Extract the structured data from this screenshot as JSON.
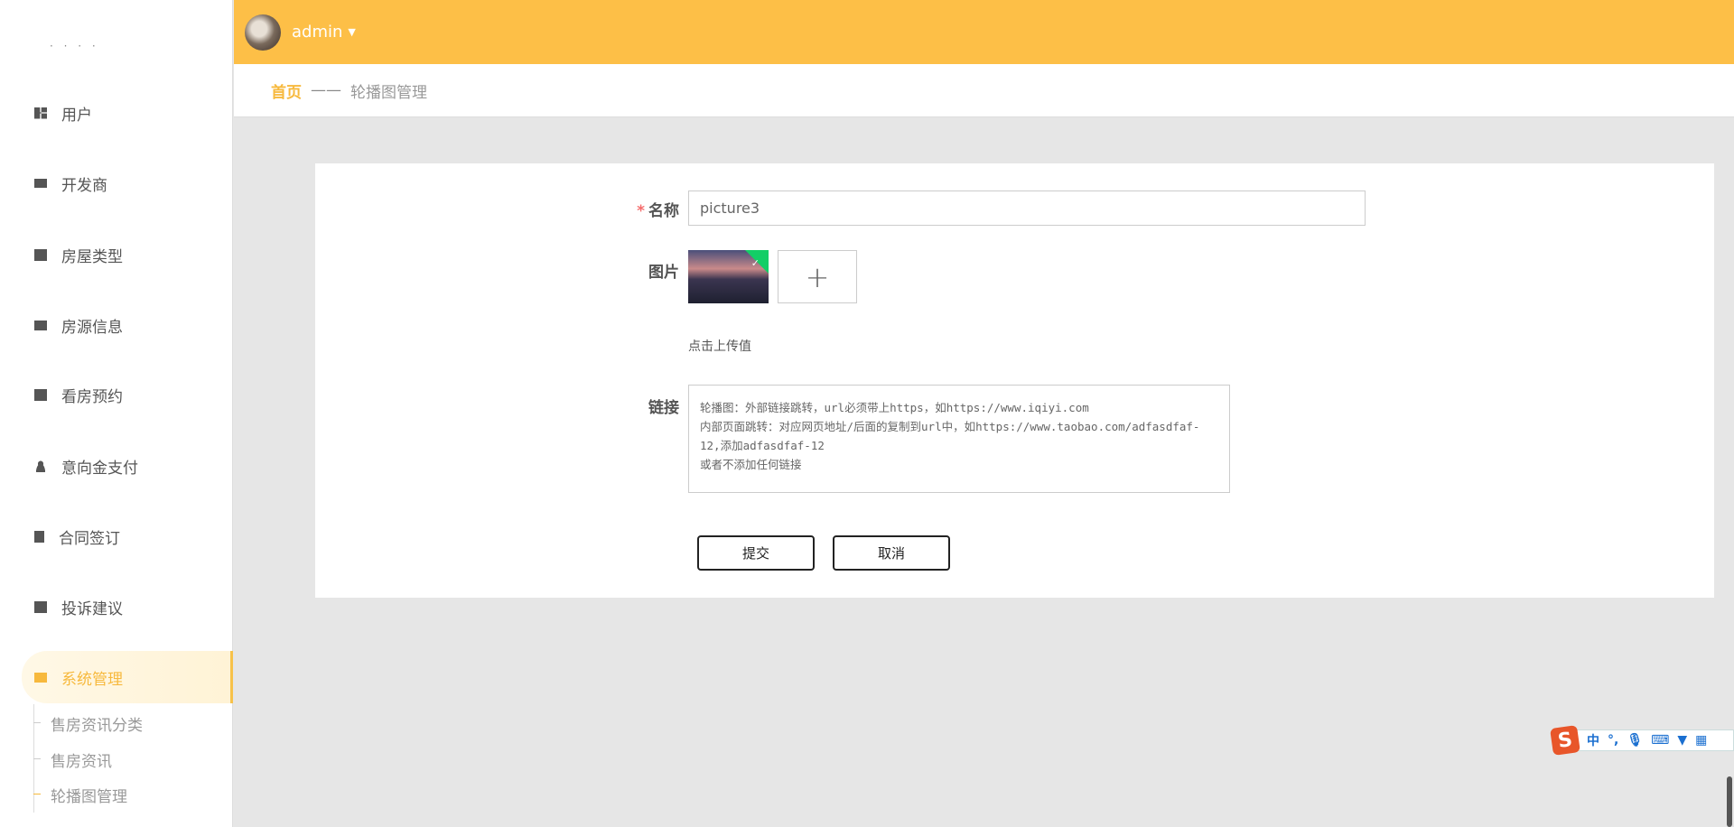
{
  "sidebar": {
    "logo": "· · · ·",
    "items": [
      {
        "label": "用户",
        "icon": "grid-icon"
      },
      {
        "label": "开发商",
        "icon": "wallet-icon"
      },
      {
        "label": "房屋类型",
        "icon": "grid-icon"
      },
      {
        "label": "房源信息",
        "icon": "briefcase-icon"
      },
      {
        "label": "看房预约",
        "icon": "book-icon"
      },
      {
        "label": "意向金支付",
        "icon": "user-icon"
      },
      {
        "label": "合同签订",
        "icon": "clipboard-icon"
      },
      {
        "label": "投诉建议",
        "icon": "grid-icon"
      },
      {
        "label": "系统管理",
        "icon": "monitor-icon",
        "active": true
      }
    ],
    "subitems": [
      {
        "label": "售房资讯分类"
      },
      {
        "label": "售房资讯"
      },
      {
        "label": "轮播图管理",
        "active": true
      }
    ]
  },
  "header": {
    "username": "admin",
    "accent": "#fdbf47"
  },
  "breadcrumb": {
    "home": "首页",
    "separator": "——",
    "current": "轮播图管理"
  },
  "form": {
    "name_label": "名称",
    "required_mark": "*",
    "name_value": "picture3",
    "image_label": "图片",
    "upload_hint": "点击上传值",
    "link_label": "链接",
    "link_value": "轮播图：外部链接跳转，url必须带上https，如https://www.iqiyi.com\n内部页面跳转：对应网页地址/后面的复制到url中，如https://www.taobao.com/adfasdfaf-12,添加adfasdfaf-12\n或者不添加任何链接",
    "submit": "提交",
    "cancel": "取消"
  },
  "ime": {
    "logo": "S",
    "mode": "中",
    "punct": "°,"
  }
}
